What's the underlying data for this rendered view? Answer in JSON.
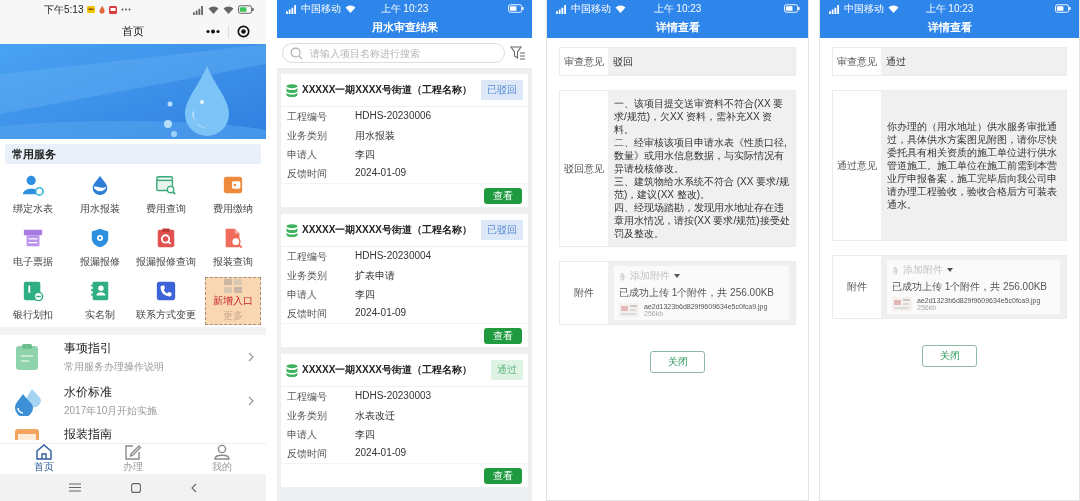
{
  "home": {
    "status_bar": {
      "time": "下午5:13"
    },
    "title": "首页",
    "services": {
      "title": "常用服务",
      "items": [
        {
          "kind": "service",
          "label": "绑定水表"
        },
        {
          "kind": "service",
          "label": "用水报装"
        },
        {
          "kind": "service",
          "label": "费用查询"
        },
        {
          "kind": "service",
          "label": "费用缴纳"
        },
        {
          "kind": "service",
          "label": "电子票据"
        },
        {
          "kind": "service",
          "label": "报漏报修"
        },
        {
          "kind": "service",
          "label": "报漏报修查询"
        },
        {
          "kind": "service",
          "label": "报装查询"
        },
        {
          "kind": "service",
          "label": "银行划扣"
        },
        {
          "kind": "service",
          "label": "实名制"
        },
        {
          "kind": "service",
          "label": "联系方式变更"
        },
        {
          "kind": "placeholder",
          "overlay": "新增入口",
          "label": "更多"
        }
      ]
    },
    "guides": [
      {
        "title": "事项指引",
        "subtitle": "常用服务办理操作说明"
      },
      {
        "title": "水价标准",
        "subtitle": "2017年10月开始实施"
      },
      {
        "title": "报装指南"
      }
    ],
    "tab_bar": [
      {
        "label": "首页",
        "selected": true
      },
      {
        "label": "办理",
        "selected": false
      },
      {
        "label": "我的",
        "selected": false
      }
    ]
  },
  "review_list": {
    "status_bar": {
      "carrier": "中国移动",
      "time": "上午 10:23"
    },
    "title": "用水审查结果",
    "search": {
      "placeholder": "请输入项目名称进行搜索"
    },
    "cards": [
      {
        "title": "XXXXX一期XXXX号街道（工程名称）",
        "status": {
          "kind": "rejected",
          "label": "已驳回"
        },
        "fields": [
          {
            "label": "工程编号",
            "value": "HDHS-20230006"
          },
          {
            "label": "业务类别",
            "value": "用水报装"
          },
          {
            "label": "申请人",
            "value": "李四"
          },
          {
            "label": "反馈时间",
            "value": "2024-01-09"
          }
        ],
        "action": "查看"
      },
      {
        "title": "XXXXX一期XXXX号街道（工程名称）",
        "status": {
          "kind": "rejected",
          "label": "已驳回"
        },
        "fields": [
          {
            "label": "工程编号",
            "value": "HDHS-20230004"
          },
          {
            "label": "业务类别",
            "value": "扩表申请"
          },
          {
            "label": "申请人",
            "value": "李四"
          },
          {
            "label": "反馈时间",
            "value": "2024-01-09"
          }
        ],
        "action": "查看"
      },
      {
        "title": "XXXXX一期XXXX号街道（工程名称）",
        "status": {
          "kind": "approved",
          "label": "通过"
        },
        "fields": [
          {
            "label": "工程编号",
            "value": "HDHS-20230003"
          },
          {
            "label": "业务类别",
            "value": "水表改迁"
          },
          {
            "label": "申请人",
            "value": "李四"
          },
          {
            "label": "反馈时间",
            "value": "2024-01-09"
          }
        ],
        "action": "查看"
      }
    ]
  },
  "details": [
    {
      "status_bar": {
        "carrier": "中国移动",
        "time": "上午 10:23"
      },
      "title": "详情查看",
      "rows": [
        {
          "kind": "text",
          "label": "审查意见",
          "value": "驳回"
        },
        {
          "kind": "paragraphs",
          "label": "驳回意见",
          "paragraphs": [
            "一、该项目提交送审资料不符合(XX 要求/规范)，欠XX 资料，需补充XX 资料。",
            "二、经审核该项目申请水表《性质口径,数量》或用水信息数据，与实际情况有异请校核修改。",
            "三、建筑物给水系统不符合 (XX 要求/规范)，建议(XX 整改)。",
            "四、经现场踏勘，发现用水地址存在违章用水情况，请按(XX 要求/规范)接受处罚及整改。"
          ]
        },
        {
          "kind": "attachment",
          "label": "附件",
          "add_label": "添加附件",
          "summary": "已成功上传 1个附件，共 256.00KB",
          "file": {
            "name": "ae2d1323b6d829f9609634e5c0fca9.jpg",
            "size": "256kb"
          }
        }
      ],
      "close_button": "关闭"
    },
    {
      "status_bar": {
        "carrier": "中国移动",
        "time": "上午 10:23"
      },
      "title": "详情查看",
      "rows": [
        {
          "kind": "text",
          "label": "审查意见",
          "value": "通过"
        },
        {
          "kind": "paragraphs",
          "label": "通过意见",
          "paragraphs": [
            "你办理的（用水地址）供水服务审批通过，具体供水方案图见附图，请你尽快委托具有相关资质的施工单位进行供水管道施工。施工单位在施工前需到本营业厅申报备案，施工完毕后向我公司申请办理工程验收，验收合格后方可装表通水。"
          ]
        },
        {
          "kind": "attachment",
          "label": "附件",
          "add_label": "添加附件",
          "summary": "已成功上传 1个附件，共 256.00KB",
          "file": {
            "name": "ae2d1323b6d829f9609634e5c0fca9.jpg",
            "size": "256kb"
          }
        }
      ],
      "close_button": "关闭"
    }
  ]
}
